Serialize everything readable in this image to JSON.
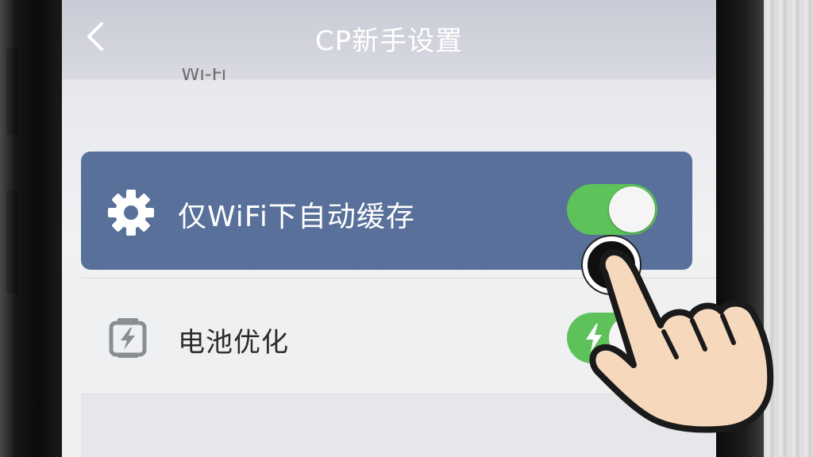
{
  "header": {
    "title": "CP新手设置",
    "back_icon": "chevron-left-icon"
  },
  "partial_row": {
    "text": "Wi-Fi"
  },
  "settings": [
    {
      "label": "仅WiFi下自动缓存",
      "icon": "gear-icon",
      "enabled": true,
      "highlighted": true
    },
    {
      "label": "电池优化",
      "icon": "battery-icon",
      "enabled": true,
      "highlighted": false
    }
  ],
  "overlay": {
    "icon": "pointing-hand-icon"
  },
  "colors": {
    "highlight": "#58709a",
    "toggle_on": "#5dc25a",
    "header": "#cfd1db"
  }
}
